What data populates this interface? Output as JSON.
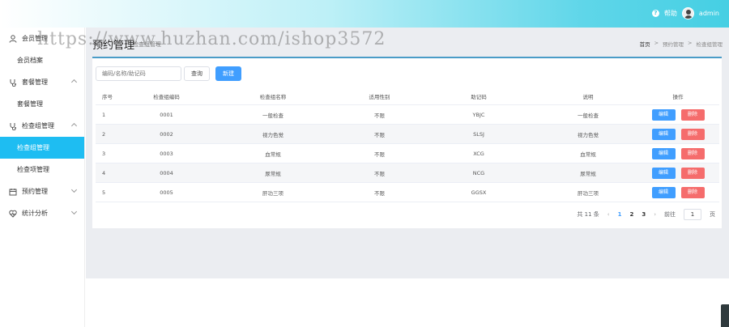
{
  "header": {
    "help_label": "帮助",
    "user_name": "admin"
  },
  "sidebar": {
    "groups": [
      {
        "label": "会员管理",
        "items": [
          "会员档案"
        ]
      },
      {
        "label": "套餐管理",
        "items": [
          "套餐管理"
        ]
      },
      {
        "label": "检查组管理",
        "items": [
          "检查组管理",
          "检查项管理"
        ]
      },
      {
        "label": "预约管理",
        "items": []
      },
      {
        "label": "统计分析",
        "items": []
      }
    ],
    "active_item": "检查组管理"
  },
  "page": {
    "title": "预约管理",
    "subtitle": "检查组管理",
    "breadcrumb": [
      "首页",
      "预约管理",
      "检查组管理"
    ]
  },
  "toolbar": {
    "search_placeholder": "编码/名称/助记码",
    "query_label": "查询",
    "new_label": "新建"
  },
  "table": {
    "headers": [
      "序号",
      "检查组编码",
      "检查组名称",
      "适用性别",
      "助记码",
      "说明",
      "操作"
    ],
    "rows": [
      {
        "idx": "1",
        "code": "0001",
        "name": "一般检查",
        "sex": "不限",
        "mnemonic": "YBJC",
        "desc": "一般检查"
      },
      {
        "idx": "2",
        "code": "0002",
        "name": "视力色觉",
        "sex": "不限",
        "mnemonic": "SLSJ",
        "desc": "视力色觉"
      },
      {
        "idx": "3",
        "code": "0003",
        "name": "血常规",
        "sex": "不限",
        "mnemonic": "XCG",
        "desc": "血常规"
      },
      {
        "idx": "4",
        "code": "0004",
        "name": "尿常规",
        "sex": "不限",
        "mnemonic": "NCG",
        "desc": "尿常规"
      },
      {
        "idx": "5",
        "code": "0005",
        "name": "肝功三项",
        "sex": "不限",
        "mnemonic": "GGSX",
        "desc": "肝功三项"
      }
    ],
    "edit_label": "编辑",
    "delete_label": "删除"
  },
  "pagination": {
    "total_text": "共 11 条",
    "pages": [
      "1",
      "2",
      "3"
    ],
    "current": "1",
    "goto_prefix": "前往",
    "goto_value": "1",
    "goto_suffix": "页"
  },
  "watermark": "https://www.huzhan.com/ishop3572",
  "colors": {
    "primary": "#409eff",
    "danger": "#f56c6c",
    "sidebar_active": "#1ebdf2",
    "header_accent": "#45cfe3"
  }
}
